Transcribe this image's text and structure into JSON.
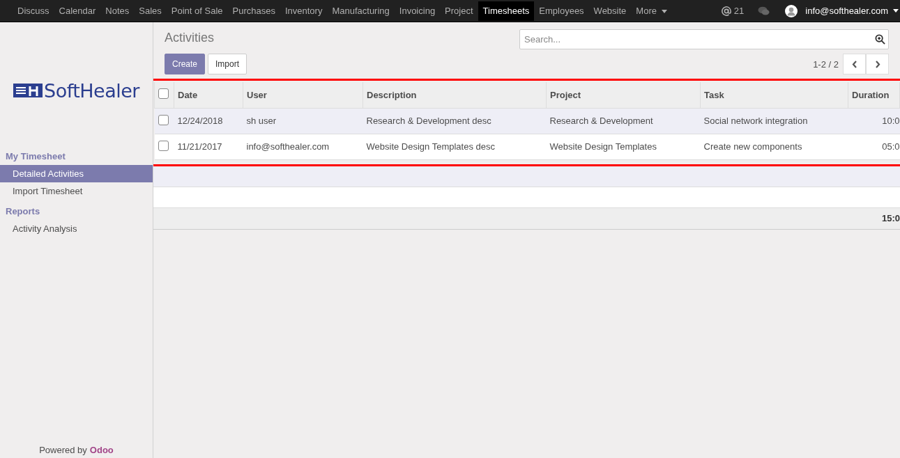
{
  "navbar": {
    "menu": [
      {
        "label": "Discuss",
        "selected": false
      },
      {
        "label": "Calendar",
        "selected": false
      },
      {
        "label": "Notes",
        "selected": false
      },
      {
        "label": "Sales",
        "selected": false
      },
      {
        "label": "Point of Sale",
        "selected": false
      },
      {
        "label": "Purchases",
        "selected": false
      },
      {
        "label": "Inventory",
        "selected": false
      },
      {
        "label": "Manufacturing",
        "selected": false
      },
      {
        "label": "Invoicing",
        "selected": false
      },
      {
        "label": "Project",
        "selected": false
      },
      {
        "label": "Timesheets",
        "selected": true
      },
      {
        "label": "Employees",
        "selected": false
      },
      {
        "label": "Website",
        "selected": false
      }
    ],
    "more": "More",
    "mentions": "21",
    "user": "info@softhealer.com"
  },
  "sidebar": {
    "logo": {
      "brand": "SoftHealer"
    },
    "sections": [
      {
        "title": "My Timesheet",
        "items": [
          {
            "label": "Detailed Activities",
            "selected": true
          },
          {
            "label": "Import Timesheet",
            "selected": false
          }
        ]
      },
      {
        "title": "Reports",
        "items": [
          {
            "label": "Activity Analysis",
            "selected": false
          }
        ]
      }
    ],
    "footer": {
      "text": "Powered by",
      "link": "Odoo"
    }
  },
  "control_panel": {
    "title": "Activities",
    "search": {
      "placeholder": "Search..."
    },
    "buttons": [
      {
        "label": "Create",
        "kind": "primary"
      },
      {
        "label": "Import",
        "kind": "secondary"
      }
    ],
    "pager": "1-2 / 2"
  },
  "table": {
    "select_all": {
      "checked": false
    },
    "columns": [
      "Date",
      "User",
      "Description",
      "Project",
      "Task",
      "Duration"
    ],
    "rows": [
      {
        "checked": false,
        "cells": [
          "12/24/2018",
          "sh user",
          "Research & Development desc",
          "Research & Development",
          "Social network integration",
          "10:0"
        ]
      },
      {
        "checked": false,
        "cells": [
          "11/21/2017",
          "info@softhealer.com",
          "Website Design Templates desc",
          "Website Design Templates",
          "Create new components",
          "05:0"
        ]
      }
    ],
    "total": "15:0"
  }
}
